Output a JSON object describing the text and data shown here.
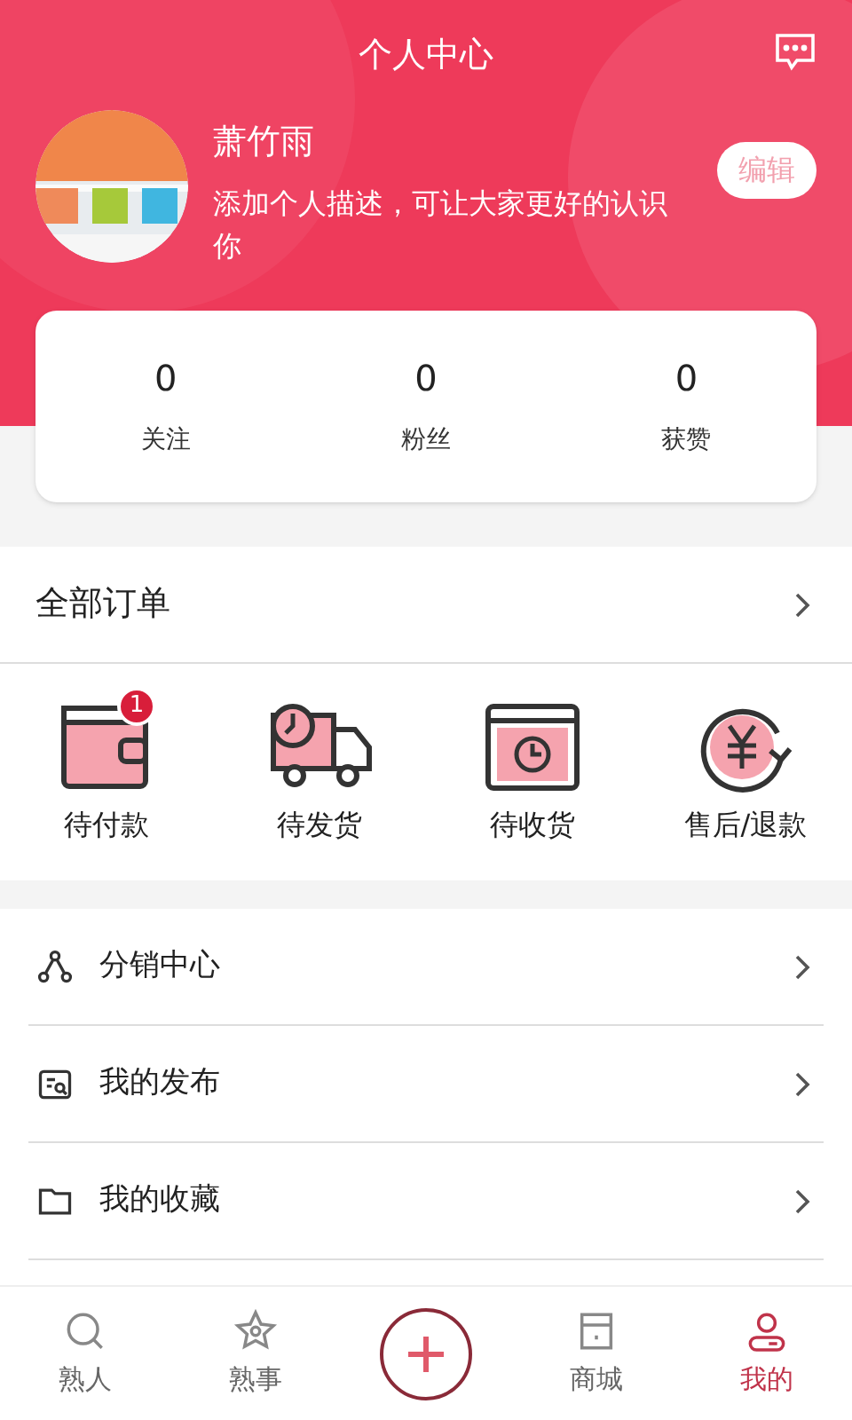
{
  "header": {
    "title": "个人中心",
    "name": "萧竹雨",
    "description": "添加个人描述，可让大家更好的认识你",
    "edit_button": "编辑"
  },
  "stats": [
    {
      "value": "0",
      "label": "关注"
    },
    {
      "value": "0",
      "label": "粉丝"
    },
    {
      "value": "0",
      "label": "获赞"
    }
  ],
  "orders": {
    "title": "全部订单",
    "items": [
      {
        "kind": "wallet",
        "label": "待付款",
        "badge": "1"
      },
      {
        "kind": "truck",
        "label": "待发货"
      },
      {
        "kind": "box",
        "label": "待收货"
      },
      {
        "kind": "refund",
        "label": "售后/退款"
      }
    ]
  },
  "menu": [
    {
      "kind": "share",
      "label": "分销中心"
    },
    {
      "kind": "publish",
      "label": "我的发布"
    },
    {
      "kind": "folder",
      "label": "我的收藏"
    }
  ],
  "tabs": [
    {
      "kind": "search",
      "label": "熟人",
      "selected": false
    },
    {
      "kind": "star",
      "label": "熟事",
      "selected": false
    },
    {
      "kind": "plus"
    },
    {
      "kind": "shop",
      "label": "商城",
      "selected": false
    },
    {
      "kind": "user",
      "label": "我的",
      "selected": true
    }
  ]
}
